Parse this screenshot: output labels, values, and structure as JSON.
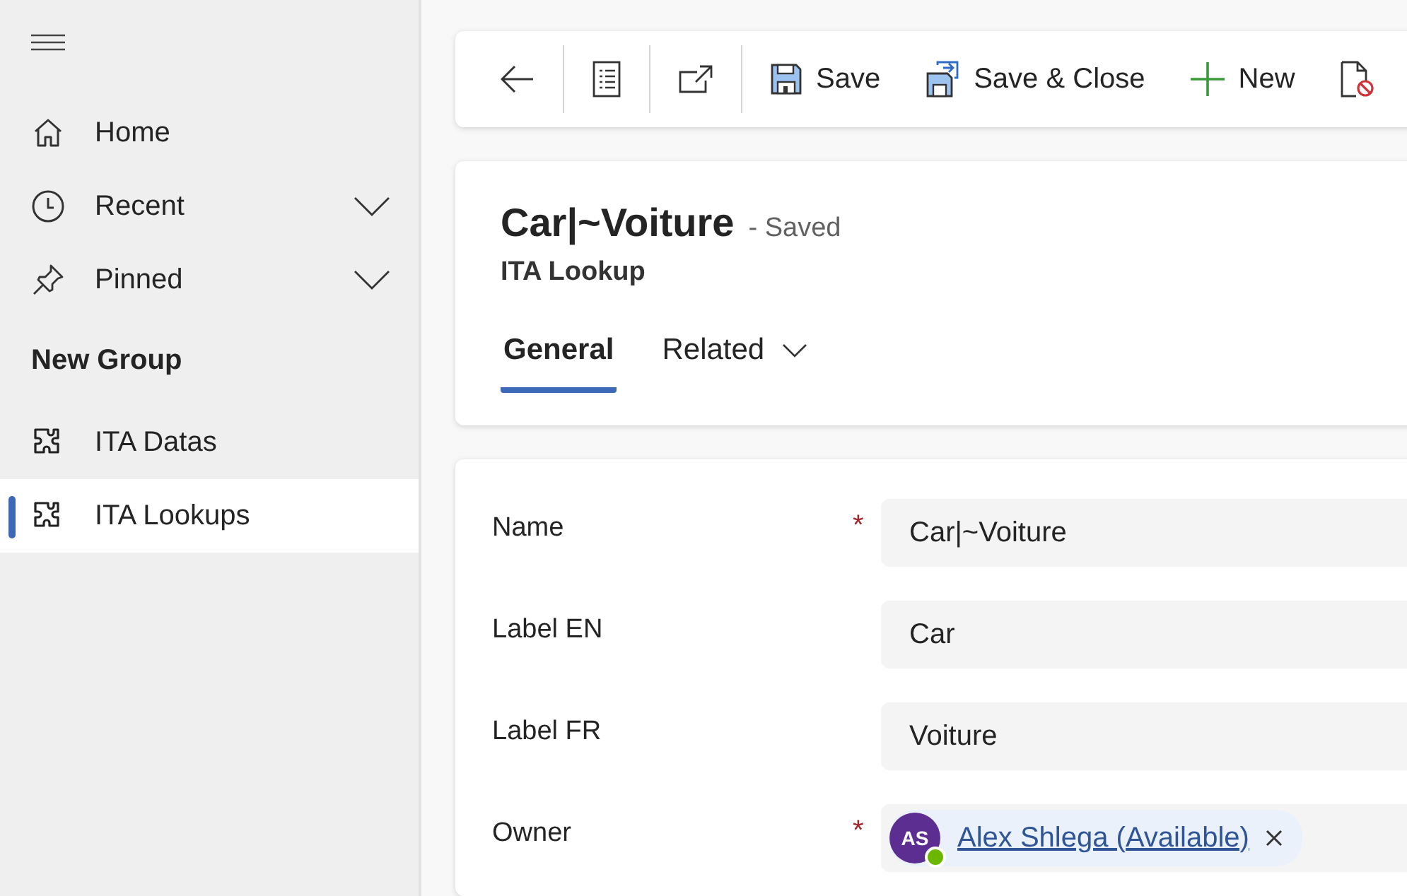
{
  "sidebar": {
    "items": [
      {
        "kind": "nav",
        "label": "Home",
        "expandable": false,
        "selected": false
      },
      {
        "kind": "nav",
        "label": "Recent",
        "expandable": true,
        "selected": false
      },
      {
        "kind": "nav",
        "label": "Pinned",
        "expandable": true,
        "selected": false
      },
      {
        "kind": "group",
        "label": "New Group"
      },
      {
        "kind": "entity",
        "label": "ITA Datas",
        "expandable": false,
        "selected": false
      },
      {
        "kind": "entity",
        "label": "ITA Lookups",
        "expandable": false,
        "selected": true
      }
    ]
  },
  "toolbar": {
    "items": [
      {
        "kind": "icon"
      },
      {
        "kind": "divider"
      },
      {
        "kind": "icon"
      },
      {
        "kind": "divider"
      },
      {
        "kind": "icon"
      },
      {
        "kind": "divider"
      },
      {
        "kind": "button",
        "label": "Save"
      },
      {
        "kind": "button",
        "label": "Save & Close"
      },
      {
        "kind": "button",
        "label": "New"
      },
      {
        "kind": "icon"
      }
    ]
  },
  "header": {
    "title": "Car|~Voiture",
    "status": "- Saved",
    "entity": "ITA Lookup",
    "tabs": [
      {
        "label": "General",
        "selected": true,
        "has_menu": false
      },
      {
        "label": "Related",
        "selected": false,
        "has_menu": true
      }
    ]
  },
  "form": {
    "fields": [
      {
        "kind": "text",
        "label": "Name",
        "required_mark": "*",
        "value": "Car|~Voiture"
      },
      {
        "kind": "text",
        "label": "Label EN",
        "value": "Car"
      },
      {
        "kind": "text",
        "label": "Label FR",
        "value": "Voiture"
      },
      {
        "kind": "lookup",
        "label": "Owner",
        "required_mark": "*",
        "initials": "AS",
        "value": "Alex Shlega (Available)",
        "online": true
      }
    ]
  }
}
